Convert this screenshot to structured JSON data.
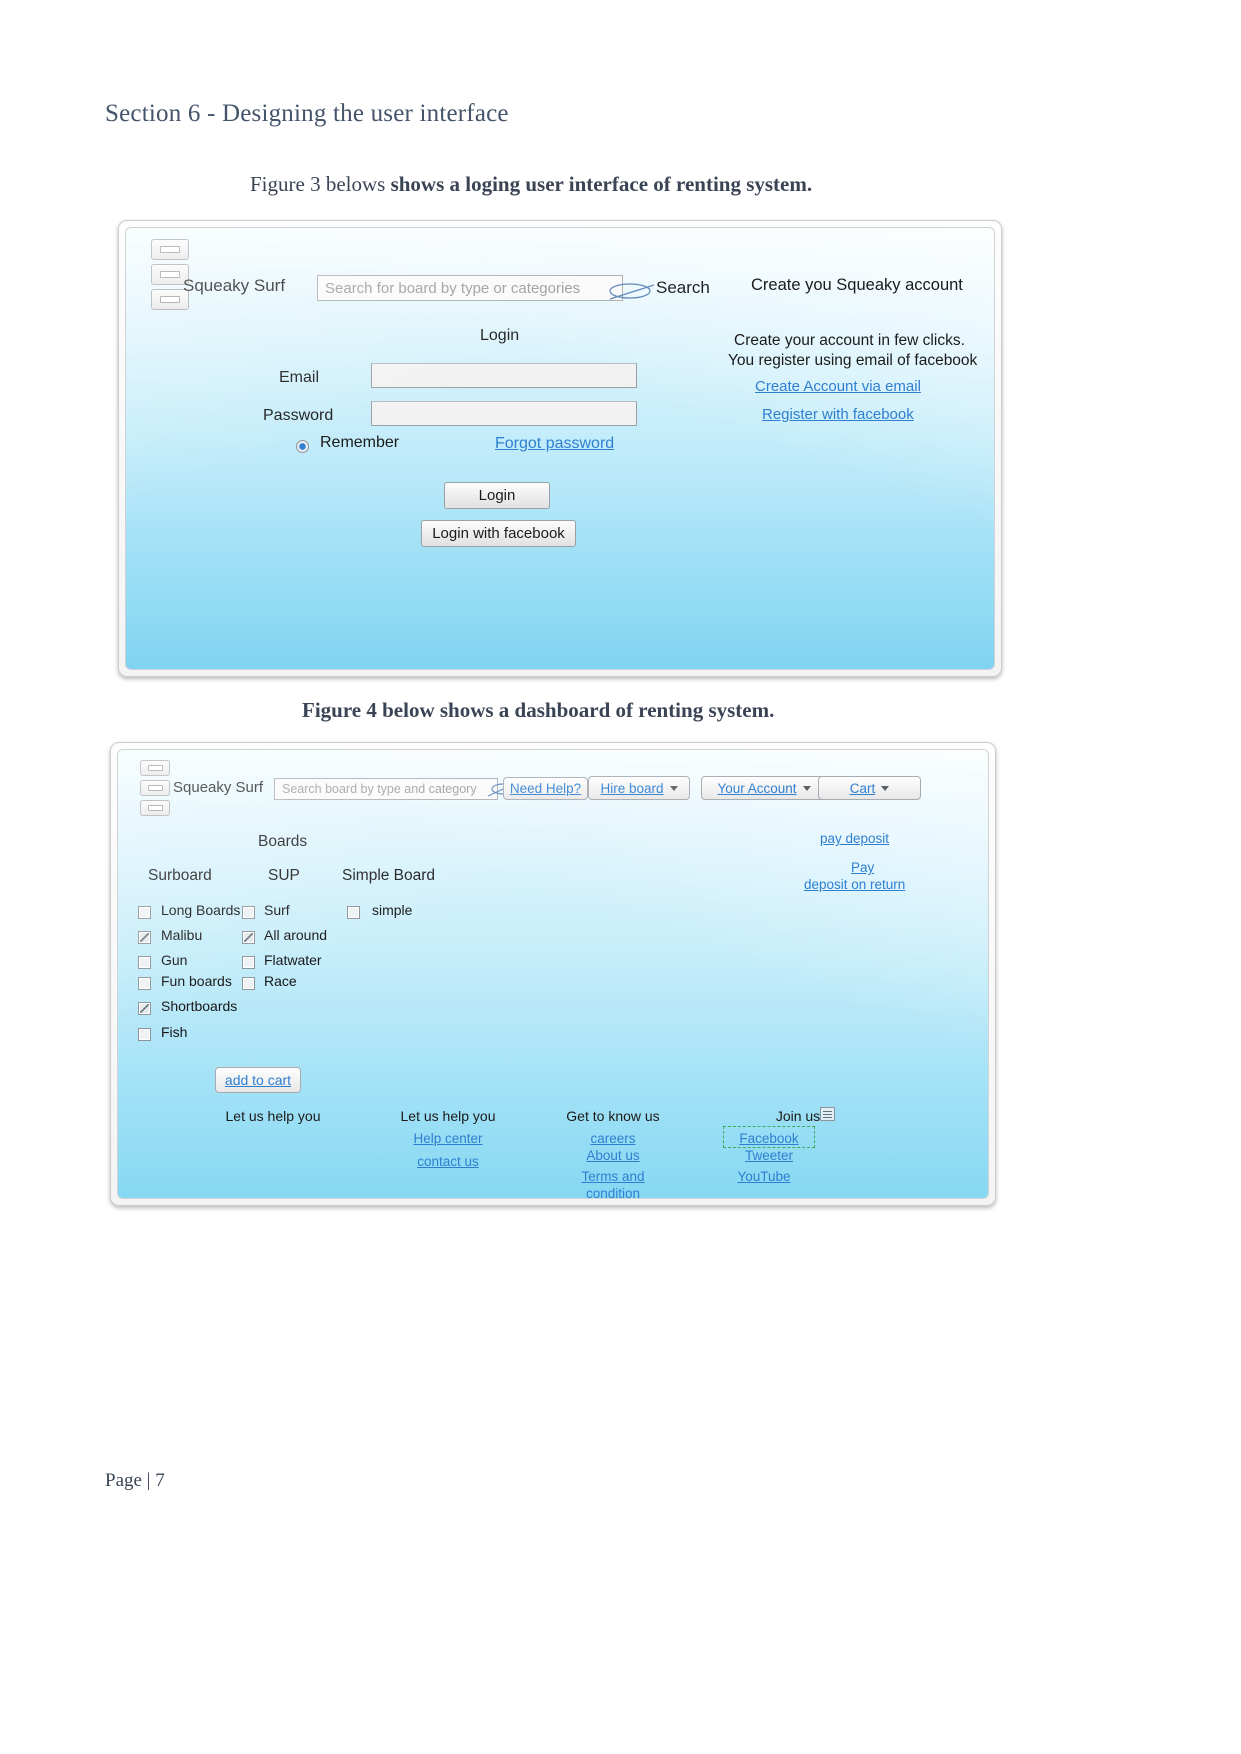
{
  "document": {
    "section_title": "Section 6 - Designing the user interface",
    "figure3_caption_light": "Figure 3 belows ",
    "figure3_caption_bold": "shows a loging user interface of  renting system.",
    "figure4_caption": "Figure 4 below shows a dashboard of renting system.",
    "page_number": "Page | 7"
  },
  "login_mockup": {
    "brand": "Squeaky Surf",
    "search_placeholder": "Search for board by type or categories",
    "search_label": "Search",
    "form_title": "Login",
    "email_label": "Email",
    "password_label": "Password",
    "remember_label": "Remember",
    "forgot_link": "Forgot password",
    "login_button": "Login",
    "facebook_button": "Login with facebook",
    "create_heading": "Create you Squeaky account",
    "create_line1": "Create your account in few clicks.",
    "create_line2": "You register using email of facebook",
    "create_email_link": "Create Account via email",
    "register_facebook_link": "Register with facebook"
  },
  "dashboard_mockup": {
    "brand": "Squeaky Surf",
    "search_placeholder": "Search board by type and category",
    "nav": [
      {
        "label": "Need Help?",
        "caret": false
      },
      {
        "label": "Hire board",
        "caret": true
      },
      {
        "label": "Your Account",
        "caret": true
      },
      {
        "label": "Cart",
        "caret": true
      }
    ],
    "boards_heading": "Boards",
    "columns": [
      {
        "title": "Surboard",
        "items": [
          {
            "label": "Long Boards",
            "checked": false
          },
          {
            "label": "Malibu",
            "checked": true
          },
          {
            "label": "Gun",
            "checked": false
          },
          {
            "label": "Fun boards",
            "checked": false
          },
          {
            "label": "Shortboards",
            "checked": true
          },
          {
            "label": "Fish",
            "checked": false
          }
        ]
      },
      {
        "title": "SUP",
        "items": [
          {
            "label": "Surf",
            "checked": false
          },
          {
            "label": "All around",
            "checked": true
          },
          {
            "label": "Flatwater",
            "checked": false
          },
          {
            "label": "Race",
            "checked": false
          }
        ]
      },
      {
        "title": "Simple Board",
        "items": [
          {
            "label": "simple",
            "checked": false
          }
        ]
      }
    ],
    "add_to_cart": "add to cart",
    "deposit_links": {
      "pay_deposit": "pay deposit",
      "pay": "Pay",
      "deposit_on_return": "deposit on return"
    },
    "footer": {
      "col1_title": "Let us help you",
      "col2_title": "Let us help you",
      "col2_links": [
        "Help center",
        "contact us"
      ],
      "col3_title": "Get to know us",
      "col3_links": [
        "careers",
        "About us",
        "Terms and",
        "condition"
      ],
      "col4_title": "Join us",
      "col4_links": [
        "Facebook",
        "Tweeter",
        "YouTube"
      ]
    }
  },
  "colors": {
    "heading": "#44546a",
    "link": "#2f7fd0",
    "selection": "#3faa5a"
  }
}
